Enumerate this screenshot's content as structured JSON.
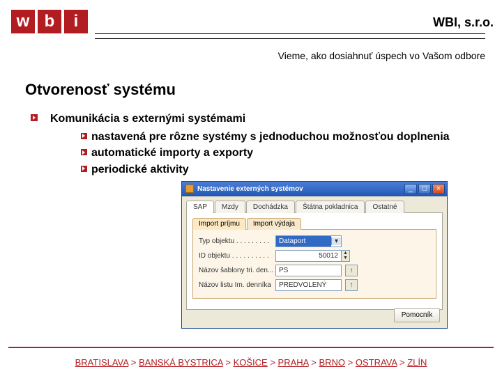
{
  "header": {
    "logo_letters": [
      "w",
      "b",
      "i"
    ],
    "company": "WBI, s.r.o.",
    "tagline": "Vieme, ako dosiahnuť úspech vo Vašom odbore"
  },
  "title": "Otvorenosť systému",
  "bullets": {
    "main": "Komunikácia s externými systémami",
    "subs": [
      "nastavená pre rôzne systémy s jednoduchou možnosťou doplnenia",
      "automatické importy a exporty",
      "periodické aktivity"
    ]
  },
  "window": {
    "title": "Nastavenie externých systémov",
    "minimize": "_",
    "maximize": "□",
    "close": "×",
    "tabs1": [
      "SAP",
      "Mzdy",
      "Dochádzka",
      "Štátna pokladnica",
      "Ostatné"
    ],
    "tabs1_active": 0,
    "tabs2": [
      "Import príjmu",
      "Import výdaja"
    ],
    "tabs2_active": 0,
    "fields": [
      {
        "label": "Typ objektu",
        "value": "Dataport",
        "mode": "select_hl"
      },
      {
        "label": "ID objektu",
        "value": "50012",
        "mode": "number"
      },
      {
        "label": "Názov šablony tri. den...",
        "value": "PS",
        "mode": "text_arrow"
      },
      {
        "label": "Názov listu Im. denníka",
        "value": "PREDVOLENÝ",
        "mode": "text_arrow"
      }
    ],
    "help": "Pomocník"
  },
  "footer": {
    "cities": [
      "BRATISLAVA",
      "BANSKÁ BYSTRICA",
      "KOŠICE",
      "PRAHA",
      "BRNO",
      "OSTRAVA",
      "ZLÍN"
    ],
    "sep": ">"
  }
}
